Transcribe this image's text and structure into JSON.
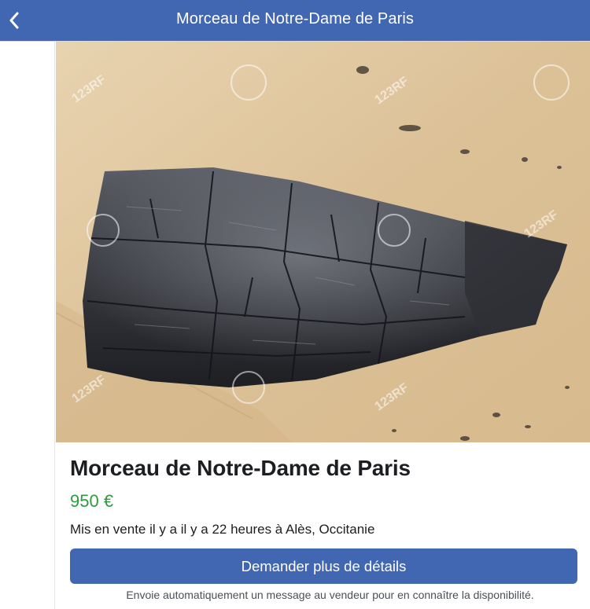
{
  "header": {
    "title": "Morceau de Notre-Dame de Paris",
    "back_icon": "chevron-left-icon"
  },
  "listing": {
    "image_alt": "Morceau de bois calciné",
    "watermark": "123RF",
    "title": "Morceau de Notre-Dame de Paris",
    "price": "950 €",
    "meta": "Mis en vente il y a il y a 22 heures à Alès, Occitanie",
    "cta_label": "Demander plus de détails",
    "cta_note": "Envoie automatiquement un message au vendeur pour en connaître la disponibilité."
  },
  "colors": {
    "brand": "#4267b2",
    "price": "#2e9a3d",
    "text": "#1c1e21"
  }
}
